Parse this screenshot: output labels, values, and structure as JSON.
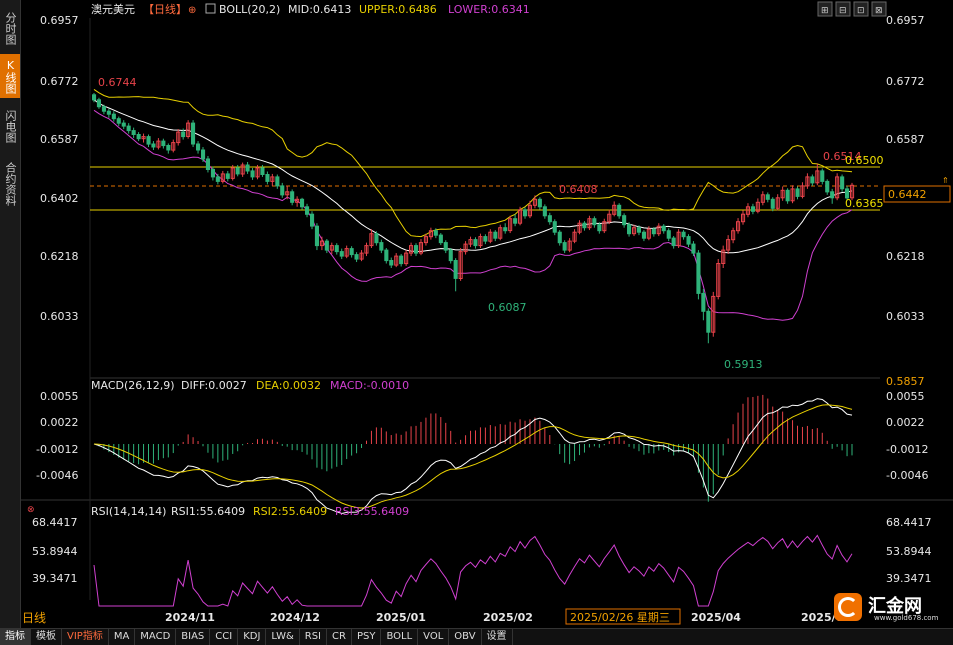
{
  "side_tabs": [
    {
      "label": "分时图",
      "active": false
    },
    {
      "label": "K线图",
      "active": true
    },
    {
      "label": "闪电图",
      "active": false
    },
    {
      "label": "合约资料",
      "active": false
    }
  ],
  "header": {
    "symbol": "澳元美元",
    "period": "【日线】",
    "boll_label": "BOLL(20,2)",
    "mid": "MID:0.6413",
    "upper": "UPPER:0.6486",
    "lower": "LOWER:0.6341"
  },
  "macd_header": {
    "label": "MACD(26,12,9)",
    "diff": "DIFF:0.0027",
    "dea": "DEA:0.0032",
    "macd": "MACD:-0.0010"
  },
  "rsi_header": {
    "label": "RSI(14,14,14)",
    "rsi1": "RSI1:55.6409",
    "rsi2": "RSI2:55.6409",
    "rsi3": "RSI3:55.6409"
  },
  "price_ticks": [
    "0.6957",
    "0.6772",
    "0.6587",
    "0.6402",
    "0.6218",
    "0.6033"
  ],
  "macd_ticks": [
    "0.0055",
    "0.0022",
    "-0.0012",
    "-0.0046"
  ],
  "rsi_ticks": [
    "68.4417",
    "53.8944",
    "39.3471"
  ],
  "price_tag": "0.6442",
  "bottom_value": "0.5857",
  "annotations": {
    "high_start": "0.6744",
    "low1": "0.6087",
    "high_mid": "0.6408",
    "low2": "0.5913",
    "high_end": "0.6514",
    "line_upper": "0.6500",
    "line_lower": "0.6365"
  },
  "date_labels": [
    "2024/11",
    "2024/12",
    "2025/01",
    "2025/02",
    "2025/04",
    "2025/0"
  ],
  "crosshair_date": "2025/02/26 星期三",
  "timeframe": "日线",
  "toolbar": [
    "指标",
    "模板",
    "VIP指标",
    "MA",
    "MACD",
    "BIAS",
    "CCI",
    "KDJ",
    "LW&",
    "RSI",
    "CR",
    "PSY",
    "BOLL",
    "VOL",
    "OBV",
    "设置"
  ],
  "logo": {
    "name": "汇金网",
    "url": "www.gold678.com"
  },
  "colors": {
    "up": "#e8434a",
    "down": "#2fb37a",
    "boll_mid": "#ffffff",
    "boll_upper": "#e8d000",
    "boll_lower": "#d040d0",
    "accent": "#e07000"
  },
  "chart_data": {
    "type": "candlestick",
    "y_range_price": [
      0.5857,
      0.7002
    ],
    "y_range_macd": [
      -0.0062,
      0.0062
    ],
    "y_range_rsi": [
      30,
      72
    ],
    "horizontal_lines": [
      0.65,
      0.6365
    ],
    "last_price": 0.6442,
    "candles": [
      {
        "o": 0.6745,
        "c": 0.6728,
        "h": 0.6751,
        "l": 0.672
      },
      {
        "o": 0.6728,
        "c": 0.6705,
        "h": 0.6735,
        "l": 0.6698
      },
      {
        "o": 0.6705,
        "c": 0.669,
        "h": 0.6712,
        "l": 0.668
      },
      {
        "o": 0.669,
        "c": 0.668,
        "h": 0.6698,
        "l": 0.6668
      },
      {
        "o": 0.668,
        "c": 0.6665,
        "h": 0.669,
        "l": 0.6655
      },
      {
        "o": 0.6665,
        "c": 0.665,
        "h": 0.6672,
        "l": 0.664
      },
      {
        "o": 0.665,
        "c": 0.664,
        "h": 0.666,
        "l": 0.663
      },
      {
        "o": 0.664,
        "c": 0.6625,
        "h": 0.665,
        "l": 0.6615
      },
      {
        "o": 0.6625,
        "c": 0.6612,
        "h": 0.6635,
        "l": 0.66
      },
      {
        "o": 0.6612,
        "c": 0.6598,
        "h": 0.662,
        "l": 0.659
      },
      {
        "o": 0.6598,
        "c": 0.6605,
        "h": 0.6615,
        "l": 0.6585
      },
      {
        "o": 0.6605,
        "c": 0.658,
        "h": 0.6612,
        "l": 0.657
      },
      {
        "o": 0.658,
        "c": 0.657,
        "h": 0.659,
        "l": 0.656
      },
      {
        "o": 0.657,
        "c": 0.659,
        "h": 0.66,
        "l": 0.6562
      },
      {
        "o": 0.659,
        "c": 0.6575,
        "h": 0.6598,
        "l": 0.6565
      },
      {
        "o": 0.6575,
        "c": 0.656,
        "h": 0.6582,
        "l": 0.6548
      },
      {
        "o": 0.656,
        "c": 0.6585,
        "h": 0.6595,
        "l": 0.6552
      },
      {
        "o": 0.6585,
        "c": 0.662,
        "h": 0.663,
        "l": 0.6575
      },
      {
        "o": 0.662,
        "c": 0.6605,
        "h": 0.6632,
        "l": 0.6595
      },
      {
        "o": 0.6605,
        "c": 0.665,
        "h": 0.666,
        "l": 0.6598
      },
      {
        "o": 0.665,
        "c": 0.658,
        "h": 0.666,
        "l": 0.657
      },
      {
        "o": 0.658,
        "c": 0.656,
        "h": 0.659,
        "l": 0.6548
      },
      {
        "o": 0.656,
        "c": 0.653,
        "h": 0.657,
        "l": 0.652
      },
      {
        "o": 0.653,
        "c": 0.6495,
        "h": 0.654,
        "l": 0.6485
      },
      {
        "o": 0.6495,
        "c": 0.647,
        "h": 0.6505,
        "l": 0.6458
      },
      {
        "o": 0.647,
        "c": 0.6455,
        "h": 0.648,
        "l": 0.6445
      },
      {
        "o": 0.6455,
        "c": 0.648,
        "h": 0.649,
        "l": 0.6448
      },
      {
        "o": 0.648,
        "c": 0.6465,
        "h": 0.649,
        "l": 0.6455
      },
      {
        "o": 0.6465,
        "c": 0.65,
        "h": 0.651,
        "l": 0.6458
      },
      {
        "o": 0.65,
        "c": 0.648,
        "h": 0.651,
        "l": 0.6472
      },
      {
        "o": 0.648,
        "c": 0.651,
        "h": 0.6518,
        "l": 0.647
      },
      {
        "o": 0.651,
        "c": 0.649,
        "h": 0.652,
        "l": 0.648
      },
      {
        "o": 0.649,
        "c": 0.647,
        "h": 0.65,
        "l": 0.646
      },
      {
        "o": 0.647,
        "c": 0.65,
        "h": 0.651,
        "l": 0.6462
      },
      {
        "o": 0.65,
        "c": 0.6478,
        "h": 0.651,
        "l": 0.647
      },
      {
        "o": 0.6478,
        "c": 0.6455,
        "h": 0.6488,
        "l": 0.6445
      },
      {
        "o": 0.6455,
        "c": 0.647,
        "h": 0.648,
        "l": 0.644
      },
      {
        "o": 0.647,
        "c": 0.644,
        "h": 0.6478,
        "l": 0.643
      },
      {
        "o": 0.644,
        "c": 0.641,
        "h": 0.645,
        "l": 0.64
      },
      {
        "o": 0.641,
        "c": 0.642,
        "h": 0.644,
        "l": 0.6395
      },
      {
        "o": 0.642,
        "c": 0.6385,
        "h": 0.6428,
        "l": 0.6375
      },
      {
        "o": 0.6385,
        "c": 0.6395,
        "h": 0.6405,
        "l": 0.637
      },
      {
        "o": 0.6395,
        "c": 0.637,
        "h": 0.64,
        "l": 0.636
      },
      {
        "o": 0.637,
        "c": 0.6345,
        "h": 0.638,
        "l": 0.6335
      },
      {
        "o": 0.6345,
        "c": 0.6305,
        "h": 0.6355,
        "l": 0.6295
      },
      {
        "o": 0.6305,
        "c": 0.624,
        "h": 0.6315,
        "l": 0.6225
      },
      {
        "o": 0.624,
        "c": 0.6255,
        "h": 0.627,
        "l": 0.6225
      },
      {
        "o": 0.6255,
        "c": 0.6225,
        "h": 0.6262,
        "l": 0.6215
      },
      {
        "o": 0.6225,
        "c": 0.624,
        "h": 0.625,
        "l": 0.6212
      },
      {
        "o": 0.624,
        "c": 0.622,
        "h": 0.6248,
        "l": 0.621
      },
      {
        "o": 0.622,
        "c": 0.6205,
        "h": 0.623,
        "l": 0.6195
      },
      {
        "o": 0.6205,
        "c": 0.623,
        "h": 0.624,
        "l": 0.6198
      },
      {
        "o": 0.623,
        "c": 0.621,
        "h": 0.6238,
        "l": 0.62
      },
      {
        "o": 0.621,
        "c": 0.6195,
        "h": 0.6218,
        "l": 0.6185
      },
      {
        "o": 0.6195,
        "c": 0.6215,
        "h": 0.6225,
        "l": 0.6188
      },
      {
        "o": 0.6215,
        "c": 0.624,
        "h": 0.625,
        "l": 0.6205
      },
      {
        "o": 0.624,
        "c": 0.628,
        "h": 0.6295,
        "l": 0.6232
      },
      {
        "o": 0.628,
        "c": 0.625,
        "h": 0.6288,
        "l": 0.624
      },
      {
        "o": 0.625,
        "c": 0.6225,
        "h": 0.626,
        "l": 0.6215
      },
      {
        "o": 0.6225,
        "c": 0.619,
        "h": 0.6232,
        "l": 0.618
      },
      {
        "o": 0.619,
        "c": 0.6175,
        "h": 0.62,
        "l": 0.6165
      },
      {
        "o": 0.6175,
        "c": 0.6205,
        "h": 0.6215,
        "l": 0.6168
      },
      {
        "o": 0.6205,
        "c": 0.618,
        "h": 0.6212,
        "l": 0.617
      },
      {
        "o": 0.618,
        "c": 0.6215,
        "h": 0.6225,
        "l": 0.6172
      },
      {
        "o": 0.6215,
        "c": 0.624,
        "h": 0.625,
        "l": 0.6205
      },
      {
        "o": 0.624,
        "c": 0.6215,
        "h": 0.6248,
        "l": 0.6205
      },
      {
        "o": 0.6215,
        "c": 0.625,
        "h": 0.6262,
        "l": 0.6208
      },
      {
        "o": 0.625,
        "c": 0.627,
        "h": 0.628,
        "l": 0.624
      },
      {
        "o": 0.627,
        "c": 0.629,
        "h": 0.63,
        "l": 0.626
      },
      {
        "o": 0.629,
        "c": 0.6275,
        "h": 0.6298,
        "l": 0.6265
      },
      {
        "o": 0.6275,
        "c": 0.625,
        "h": 0.6282,
        "l": 0.6242
      },
      {
        "o": 0.625,
        "c": 0.6225,
        "h": 0.6258,
        "l": 0.6215
      },
      {
        "o": 0.6225,
        "c": 0.619,
        "h": 0.6232,
        "l": 0.618
      },
      {
        "o": 0.619,
        "c": 0.613,
        "h": 0.6198,
        "l": 0.6087
      },
      {
        "o": 0.613,
        "c": 0.622,
        "h": 0.6232,
        "l": 0.6122
      },
      {
        "o": 0.622,
        "c": 0.6245,
        "h": 0.6255,
        "l": 0.621
      },
      {
        "o": 0.6245,
        "c": 0.626,
        "h": 0.627,
        "l": 0.6235
      },
      {
        "o": 0.626,
        "c": 0.624,
        "h": 0.6268,
        "l": 0.623
      },
      {
        "o": 0.624,
        "c": 0.627,
        "h": 0.628,
        "l": 0.6232
      },
      {
        "o": 0.627,
        "c": 0.6255,
        "h": 0.6278,
        "l": 0.6245
      },
      {
        "o": 0.6255,
        "c": 0.6285,
        "h": 0.6295,
        "l": 0.6248
      },
      {
        "o": 0.6285,
        "c": 0.6265,
        "h": 0.6292,
        "l": 0.6255
      },
      {
        "o": 0.6265,
        "c": 0.63,
        "h": 0.631,
        "l": 0.6258
      },
      {
        "o": 0.63,
        "c": 0.629,
        "h": 0.6315,
        "l": 0.628
      },
      {
        "o": 0.629,
        "c": 0.633,
        "h": 0.634,
        "l": 0.6282
      },
      {
        "o": 0.633,
        "c": 0.6315,
        "h": 0.6345,
        "l": 0.6305
      },
      {
        "o": 0.6315,
        "c": 0.636,
        "h": 0.637,
        "l": 0.6308
      },
      {
        "o": 0.636,
        "c": 0.634,
        "h": 0.6368,
        "l": 0.633
      },
      {
        "o": 0.634,
        "c": 0.6375,
        "h": 0.639,
        "l": 0.6332
      },
      {
        "o": 0.6375,
        "c": 0.6395,
        "h": 0.6408,
        "l": 0.6365
      },
      {
        "o": 0.6395,
        "c": 0.637,
        "h": 0.6402,
        "l": 0.636
      },
      {
        "o": 0.637,
        "c": 0.634,
        "h": 0.6378,
        "l": 0.633
      },
      {
        "o": 0.634,
        "c": 0.632,
        "h": 0.635,
        "l": 0.631
      },
      {
        "o": 0.632,
        "c": 0.6285,
        "h": 0.6328,
        "l": 0.6275
      },
      {
        "o": 0.6285,
        "c": 0.625,
        "h": 0.6292,
        "l": 0.624
      },
      {
        "o": 0.625,
        "c": 0.6225,
        "h": 0.6258,
        "l": 0.6215
      },
      {
        "o": 0.6225,
        "c": 0.6255,
        "h": 0.6265,
        "l": 0.6218
      },
      {
        "o": 0.6255,
        "c": 0.6285,
        "h": 0.6295,
        "l": 0.6248
      },
      {
        "o": 0.6285,
        "c": 0.6315,
        "h": 0.6325,
        "l": 0.6278
      },
      {
        "o": 0.6315,
        "c": 0.63,
        "h": 0.6322,
        "l": 0.629
      },
      {
        "o": 0.63,
        "c": 0.633,
        "h": 0.634,
        "l": 0.6292
      },
      {
        "o": 0.633,
        "c": 0.631,
        "h": 0.6338,
        "l": 0.63
      },
      {
        "o": 0.631,
        "c": 0.629,
        "h": 0.6318,
        "l": 0.628
      },
      {
        "o": 0.629,
        "c": 0.632,
        "h": 0.633,
        "l": 0.6282
      },
      {
        "o": 0.632,
        "c": 0.6345,
        "h": 0.636,
        "l": 0.6312
      },
      {
        "o": 0.6345,
        "c": 0.6375,
        "h": 0.6388,
        "l": 0.6338
      },
      {
        "o": 0.6375,
        "c": 0.634,
        "h": 0.6382,
        "l": 0.633
      },
      {
        "o": 0.634,
        "c": 0.631,
        "h": 0.6348,
        "l": 0.63
      },
      {
        "o": 0.631,
        "c": 0.628,
        "h": 0.6318,
        "l": 0.627
      },
      {
        "o": 0.628,
        "c": 0.63,
        "h": 0.631,
        "l": 0.6272
      },
      {
        "o": 0.63,
        "c": 0.6285,
        "h": 0.6308,
        "l": 0.6275
      },
      {
        "o": 0.6285,
        "c": 0.6265,
        "h": 0.6292,
        "l": 0.6255
      },
      {
        "o": 0.6265,
        "c": 0.6295,
        "h": 0.6305,
        "l": 0.6258
      },
      {
        "o": 0.6295,
        "c": 0.628,
        "h": 0.6302,
        "l": 0.627
      },
      {
        "o": 0.628,
        "c": 0.6305,
        "h": 0.6315,
        "l": 0.6272
      },
      {
        "o": 0.6305,
        "c": 0.629,
        "h": 0.6312,
        "l": 0.628
      },
      {
        "o": 0.629,
        "c": 0.6265,
        "h": 0.6298,
        "l": 0.6255
      },
      {
        "o": 0.6265,
        "c": 0.624,
        "h": 0.6272,
        "l": 0.623
      },
      {
        "o": 0.624,
        "c": 0.6285,
        "h": 0.6295,
        "l": 0.6232
      },
      {
        "o": 0.6285,
        "c": 0.627,
        "h": 0.6292,
        "l": 0.626
      },
      {
        "o": 0.627,
        "c": 0.6245,
        "h": 0.6278,
        "l": 0.6235
      },
      {
        "o": 0.6245,
        "c": 0.6215,
        "h": 0.6255,
        "l": 0.6205
      },
      {
        "o": 0.6215,
        "c": 0.608,
        "h": 0.6225,
        "l": 0.606
      },
      {
        "o": 0.608,
        "c": 0.602,
        "h": 0.6095,
        "l": 0.599
      },
      {
        "o": 0.602,
        "c": 0.595,
        "h": 0.603,
        "l": 0.5913
      },
      {
        "o": 0.595,
        "c": 0.607,
        "h": 0.6085,
        "l": 0.5935
      },
      {
        "o": 0.607,
        "c": 0.618,
        "h": 0.6195,
        "l": 0.606
      },
      {
        "o": 0.618,
        "c": 0.6225,
        "h": 0.624,
        "l": 0.6165
      },
      {
        "o": 0.6225,
        "c": 0.626,
        "h": 0.6275,
        "l": 0.6212
      },
      {
        "o": 0.626,
        "c": 0.629,
        "h": 0.63,
        "l": 0.6248
      },
      {
        "o": 0.629,
        "c": 0.632,
        "h": 0.6332,
        "l": 0.628
      },
      {
        "o": 0.632,
        "c": 0.6345,
        "h": 0.6358,
        "l": 0.631
      },
      {
        "o": 0.6345,
        "c": 0.637,
        "h": 0.6382,
        "l": 0.6335
      },
      {
        "o": 0.637,
        "c": 0.6355,
        "h": 0.638,
        "l": 0.6345
      },
      {
        "o": 0.6355,
        "c": 0.6385,
        "h": 0.6398,
        "l": 0.6348
      },
      {
        "o": 0.6385,
        "c": 0.641,
        "h": 0.6422,
        "l": 0.6375
      },
      {
        "o": 0.641,
        "c": 0.6395,
        "h": 0.6418,
        "l": 0.6385
      },
      {
        "o": 0.6395,
        "c": 0.6365,
        "h": 0.6402,
        "l": 0.6355
      },
      {
        "o": 0.6365,
        "c": 0.64,
        "h": 0.6412,
        "l": 0.6358
      },
      {
        "o": 0.64,
        "c": 0.6425,
        "h": 0.6438,
        "l": 0.639
      },
      {
        "o": 0.6425,
        "c": 0.639,
        "h": 0.6432,
        "l": 0.638
      },
      {
        "o": 0.639,
        "c": 0.643,
        "h": 0.6442,
        "l": 0.6382
      },
      {
        "o": 0.643,
        "c": 0.6405,
        "h": 0.6438,
        "l": 0.6395
      },
      {
        "o": 0.6405,
        "c": 0.644,
        "h": 0.6452,
        "l": 0.6398
      },
      {
        "o": 0.644,
        "c": 0.647,
        "h": 0.6482,
        "l": 0.643
      },
      {
        "o": 0.647,
        "c": 0.645,
        "h": 0.6478,
        "l": 0.644
      },
      {
        "o": 0.645,
        "c": 0.649,
        "h": 0.6514,
        "l": 0.6442
      },
      {
        "o": 0.649,
        "c": 0.6455,
        "h": 0.6498,
        "l": 0.6445
      },
      {
        "o": 0.6455,
        "c": 0.642,
        "h": 0.6462,
        "l": 0.641
      },
      {
        "o": 0.642,
        "c": 0.64,
        "h": 0.643,
        "l": 0.638
      },
      {
        "o": 0.64,
        "c": 0.647,
        "h": 0.6482,
        "l": 0.6392
      },
      {
        "o": 0.647,
        "c": 0.643,
        "h": 0.6478,
        "l": 0.642
      },
      {
        "o": 0.643,
        "c": 0.64,
        "h": 0.644,
        "l": 0.639
      },
      {
        "o": 0.64,
        "c": 0.6442,
        "h": 0.645,
        "l": 0.6392
      }
    ]
  }
}
